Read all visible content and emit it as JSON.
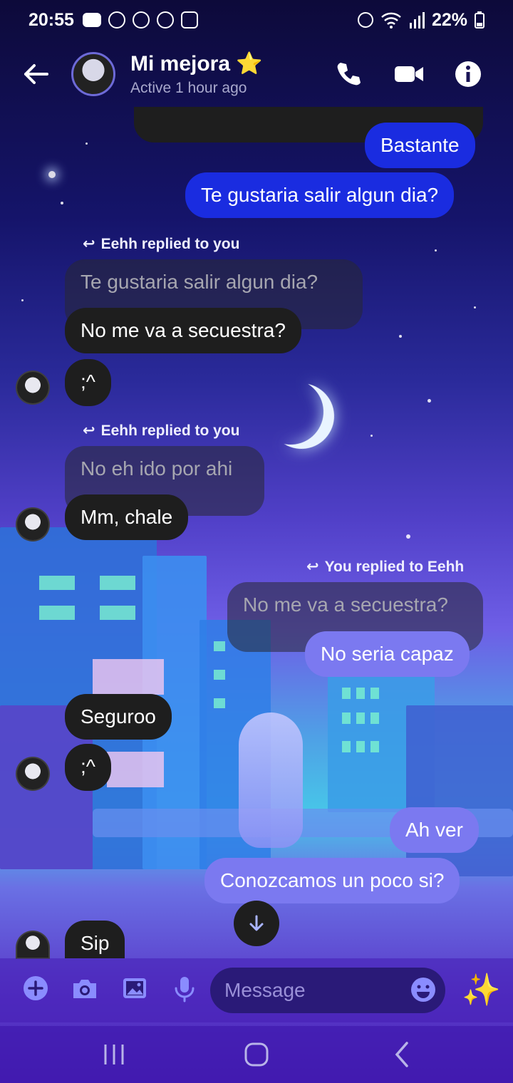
{
  "status_bar": {
    "time": "20:55",
    "battery": "22%",
    "icons": [
      "youtube-icon",
      "app-icon",
      "messenger-icon",
      "alarm-icon",
      "image-icon"
    ]
  },
  "header": {
    "contact_name": "Mi mejora",
    "name_emoji": "⭐",
    "status": "Active 1 hour ago",
    "icons": [
      "back-arrow-icon",
      "phone-icon",
      "video-icon",
      "info-icon"
    ]
  },
  "messages": [
    {
      "id": "m1",
      "text": "Bastante",
      "sender": "me"
    },
    {
      "id": "m2",
      "text": "Te gustaria salir algun dia?",
      "sender": "me"
    },
    {
      "id": "r1_label",
      "text": "Eehh replied to you"
    },
    {
      "id": "r1_quote",
      "text": "Te gustaria salir algun dia?"
    },
    {
      "id": "m3",
      "text": "No me va a secuestra?",
      "sender": "them"
    },
    {
      "id": "m4",
      "text": ";^",
      "sender": "them"
    },
    {
      "id": "r2_label",
      "text": "Eehh replied to you"
    },
    {
      "id": "r2_quote",
      "text": "No eh ido por ahi"
    },
    {
      "id": "m5",
      "text": "Mm, chale",
      "sender": "them"
    },
    {
      "id": "r3_label",
      "text": "You replied to Eehh"
    },
    {
      "id": "r3_quote",
      "text": "No me va a secuestra?"
    },
    {
      "id": "m6",
      "text": "No seria capaz",
      "sender": "me"
    },
    {
      "id": "m7",
      "text": "Seguroo",
      "sender": "them"
    },
    {
      "id": "m8",
      "text": ";^",
      "sender": "them"
    },
    {
      "id": "m9",
      "text": "Ah ver",
      "sender": "me"
    },
    {
      "id": "m10",
      "text": "Conozcamos un poco si?",
      "sender": "me"
    },
    {
      "id": "m11",
      "text": "Sip",
      "sender": "them"
    }
  ],
  "composer": {
    "placeholder": "Message",
    "sparkle": "✨",
    "icons": [
      "plus-icon",
      "camera-icon",
      "gallery-icon",
      "mic-icon",
      "emoji-icon"
    ]
  },
  "colors": {
    "sent_blue": "#1a2ce0",
    "sent_lavender": "#7b79f0",
    "received_dark": "#1e1e1e"
  }
}
